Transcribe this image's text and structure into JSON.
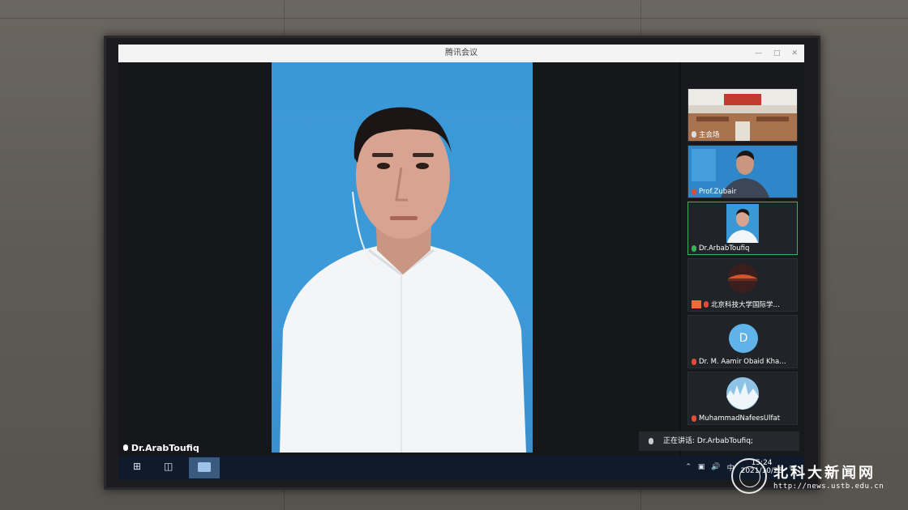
{
  "window": {
    "title": "腾讯会议"
  },
  "main_speaker": {
    "name": "Dr.ArabToufiq"
  },
  "participants": [
    {
      "name": "主会场",
      "mic": "default",
      "thumb": "conference-room"
    },
    {
      "name": "Prof.Zubair",
      "mic": "muted",
      "thumb": "person-blue"
    },
    {
      "name": "Dr.ArbabToufiq",
      "mic": "active",
      "thumb": "person-blue-small",
      "active": true
    },
    {
      "name": "北京科技大学国际学…",
      "mic": "muted",
      "thumb": "sunset"
    },
    {
      "name": "Dr.  M. Aamir Obaid Kha…",
      "mic": "muted",
      "thumb": "avatar-letter",
      "avatar_letter": "D"
    },
    {
      "name": "MuhammadNafeesUlfat",
      "mic": "muted",
      "thumb": "city"
    }
  ],
  "talking_indicator": "正在讲话: Dr.ArbabToufiq;",
  "taskbar": {
    "ime": "中",
    "time": "15:24",
    "date": "2021/10/28"
  },
  "watermark": {
    "title": "北科大新闻网",
    "url": "http://news.ustb.edu.cn"
  },
  "colors": {
    "video_background": "#3b98d6",
    "active_border": "#3fae5b",
    "mic_muted": "#e04b3a"
  }
}
